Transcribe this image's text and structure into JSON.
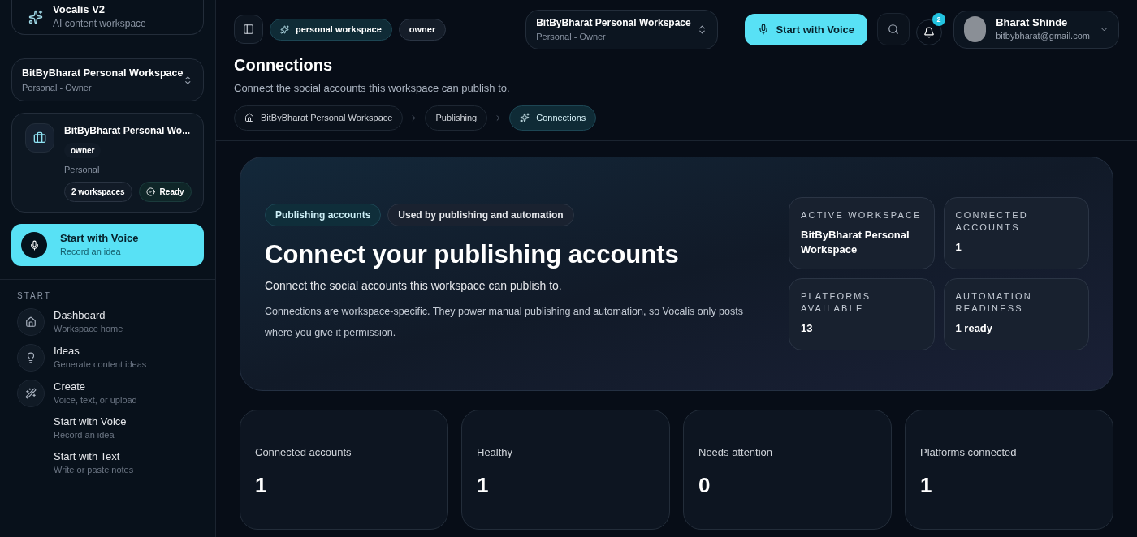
{
  "brand": {
    "name": "Vocalis V2",
    "tagline": "AI content workspace"
  },
  "sidebar_workspace_switcher": {
    "name": "BitByBharat Personal Workspace",
    "subtitle": "Personal - Owner"
  },
  "workspace_card": {
    "name": "BitByBharat Personal Wo...",
    "role": "owner",
    "type": "Personal",
    "count": "2 workspaces",
    "status": "Ready"
  },
  "sidebar_voice_button": {
    "title": "Start with Voice",
    "subtitle": "Record an idea"
  },
  "nav_section": "START",
  "nav_items": [
    {
      "kind": "icon",
      "title": "Dashboard",
      "subtitle": "Workspace home"
    },
    {
      "kind": "icon",
      "title": "Ideas",
      "subtitle": "Generate content ideas"
    },
    {
      "kind": "icon",
      "title": "Create",
      "subtitle": "Voice, text, or upload"
    },
    {
      "kind": "sub",
      "title": "Start with Voice",
      "subtitle": "Record an idea"
    },
    {
      "kind": "sub",
      "title": "Start with Text",
      "subtitle": "Write or paste notes"
    }
  ],
  "topbar": {
    "tags": [
      {
        "label": "personal workspace",
        "kind": "accent"
      },
      {
        "label": "owner",
        "kind": "plain"
      }
    ],
    "workspace": {
      "name": "BitByBharat Personal Workspace",
      "subtitle": "Personal - Owner"
    },
    "voice_button": "Start with Voice",
    "notifications": "2",
    "user": {
      "name": "Bharat Shinde",
      "email": "bitbybharat@gmail.com"
    }
  },
  "page": {
    "title": "Connections",
    "subtitle": "Connect the social accounts this workspace can publish to."
  },
  "breadcrumbs": [
    {
      "label": "BitByBharat Personal Workspace",
      "selected": false
    },
    {
      "label": "Publishing",
      "selected": false
    },
    {
      "label": "Connections",
      "selected": true
    }
  ],
  "hero": {
    "tags": [
      {
        "label": "Publishing accounts",
        "kind": "accent"
      },
      {
        "label": "Used by publishing and automation",
        "kind": "plain"
      }
    ],
    "title": "Connect your publishing accounts",
    "subtitle": "Connect the social accounts this workspace can publish to.",
    "body": "Connections are workspace-specific. They power manual publishing and automation, so Vocalis only posts where you give it permission.",
    "facts": [
      {
        "label": "ACTIVE WORKSPACE",
        "value": "BitByBharat Personal Workspace"
      },
      {
        "label": "CONNECTED ACCOUNTS",
        "value": "1"
      },
      {
        "label": "PLATFORMS AVAILABLE",
        "value": "13"
      },
      {
        "label": "AUTOMATION READINESS",
        "value": "1 ready"
      }
    ]
  },
  "stats": [
    {
      "label": "Connected accounts",
      "value": "1"
    },
    {
      "label": "Healthy",
      "value": "1"
    },
    {
      "label": "Needs attention",
      "value": "0"
    },
    {
      "label": "Platforms connected",
      "value": "1"
    }
  ]
}
